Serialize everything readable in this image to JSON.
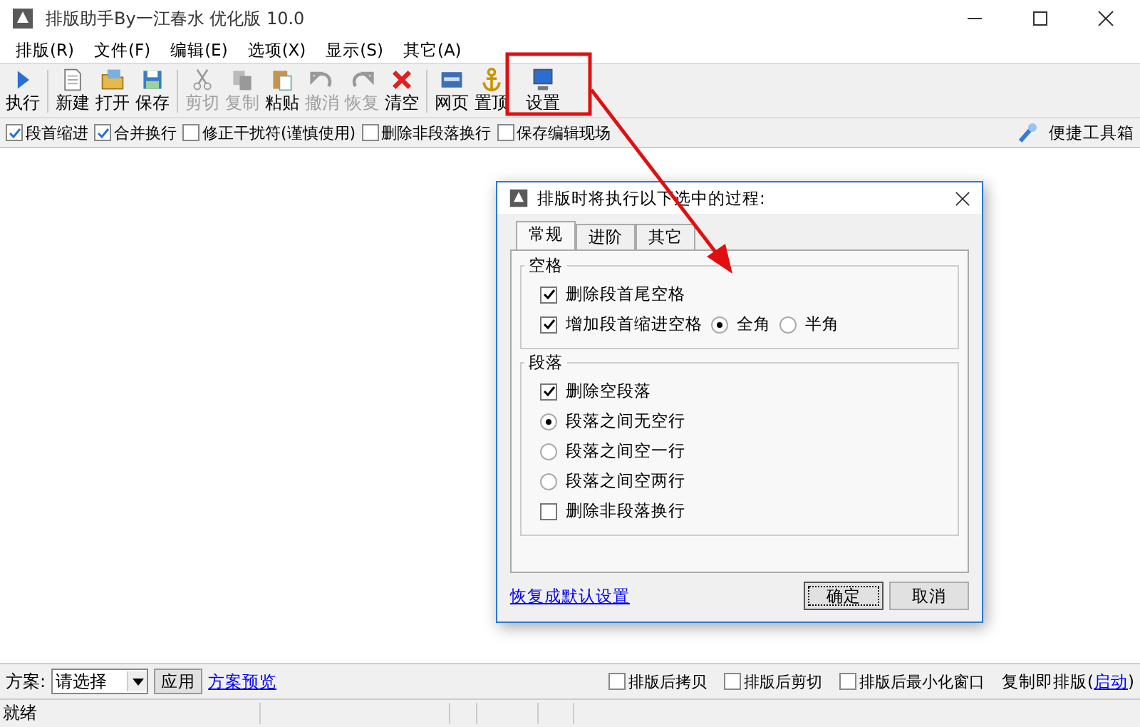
{
  "window": {
    "title": "排版助手By一江春水 优化版 10.0"
  },
  "menu": [
    "排版(R)",
    "文件(F)",
    "编辑(E)",
    "选项(X)",
    "显示(S)",
    "其它(A)"
  ],
  "toolbar": [
    [
      {
        "label": "执行",
        "disabled": false
      }
    ],
    [
      {
        "label": "新建",
        "disabled": false
      },
      {
        "label": "打开",
        "disabled": false
      },
      {
        "label": "保存",
        "disabled": false
      }
    ],
    [
      {
        "label": "剪切",
        "disabled": true
      },
      {
        "label": "复制",
        "disabled": true
      },
      {
        "label": "粘贴",
        "disabled": false
      },
      {
        "label": "撤消",
        "disabled": true
      },
      {
        "label": "恢复",
        "disabled": true
      },
      {
        "label": "清空",
        "disabled": false
      }
    ],
    [
      {
        "label": "网页",
        "disabled": false
      },
      {
        "label": "置顶",
        "disabled": false
      },
      {
        "label": "设置",
        "disabled": false,
        "highlighted": true
      }
    ]
  ],
  "options": [
    {
      "label": "段首缩进",
      "checked": true
    },
    {
      "label": "合并换行",
      "checked": true
    },
    {
      "label": "修正干扰符(谨慎使用)",
      "checked": false
    },
    {
      "label": "删除非段落换行",
      "checked": false
    },
    {
      "label": "保存编辑现场",
      "checked": false
    }
  ],
  "toolbox": {
    "label": "便捷工具箱"
  },
  "dialog": {
    "title": "排版时将执行以下选中的过程:",
    "tabs": [
      {
        "label": "常规",
        "selected": true
      },
      {
        "label": "进阶",
        "selected": false
      },
      {
        "label": "其它",
        "selected": false
      }
    ],
    "groups": [
      {
        "title": "空格",
        "rows": [
          [
            {
              "kind": "checkbox",
              "label": "删除段首尾空格",
              "checked": true
            }
          ],
          [
            {
              "kind": "checkbox",
              "label": "增加段首缩进空格",
              "checked": true
            },
            {
              "kind": "radio",
              "label": "全角",
              "selected": true
            },
            {
              "kind": "radio",
              "label": "半角",
              "selected": false
            }
          ]
        ]
      },
      {
        "title": "段落",
        "rows": [
          [
            {
              "kind": "checkbox",
              "label": "删除空段落",
              "checked": true
            }
          ],
          [
            {
              "kind": "radio",
              "label": "段落之间无空行",
              "selected": true
            }
          ],
          [
            {
              "kind": "radio",
              "label": "段落之间空一行",
              "selected": false
            }
          ],
          [
            {
              "kind": "radio",
              "label": "段落之间空两行",
              "selected": false
            }
          ],
          [
            {
              "kind": "checkbox",
              "label": "删除非段落换行",
              "checked": false
            }
          ]
        ]
      }
    ],
    "reset_link": "恢复成默认设置",
    "buttons": [
      {
        "label": "确定",
        "default": true
      },
      {
        "label": "取消",
        "default": false
      }
    ]
  },
  "scheme": {
    "label": "方案:",
    "value": "请选择",
    "apply": "应用",
    "preview_link": "方案预览"
  },
  "after_options": [
    {
      "label": "排版后拷贝",
      "checked": false
    },
    {
      "label": "排版后剪切",
      "checked": false
    },
    {
      "label": "排版后最小化窗口",
      "checked": false
    }
  ],
  "copy_typeset": {
    "label": "复制即排版(",
    "link": "启动",
    "suffix": ")"
  },
  "status_bar": {
    "text": "就绪"
  }
}
